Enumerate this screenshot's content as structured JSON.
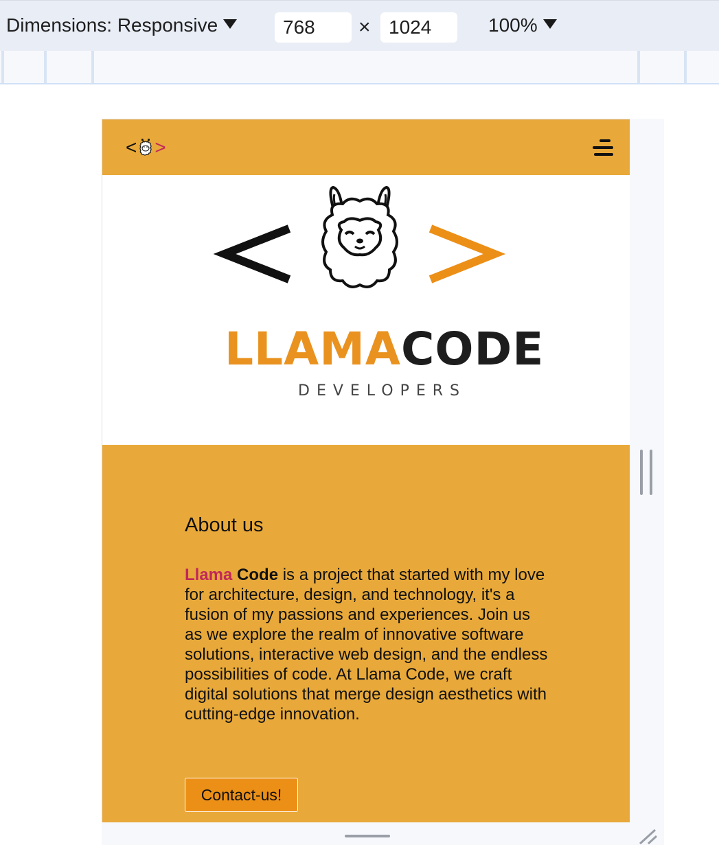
{
  "devtools": {
    "dimensions_label": "Dimensions: Responsive",
    "width_value": "768",
    "times_symbol": "×",
    "height_value": "1024",
    "zoom_label": "100%"
  },
  "site": {
    "header": {
      "logo_left": "<",
      "logo_right": ">",
      "menu_icon": "hamburger-menu-icon"
    },
    "hero": {
      "brand_part1": "LLAMA",
      "brand_part2": "CODE",
      "subtitle": "DEVELOPERS"
    },
    "about": {
      "title": "About us",
      "brand_word_1": "Llama",
      "brand_word_2": "Code",
      "body": "is a project that started with my love for architecture, design, and technology, it's a fusion of my passions and experiences. Join us as we explore the realm of innovative software solutions, interactive web design, and the endless possibilities of code. At Llama Code, we craft digital solutions that merge design aesthetics with cutting-edge innovation.",
      "cta": "Contact-us!"
    }
  },
  "colors": {
    "header_bg": "#e8a93a",
    "accent_orange": "#e9921f",
    "accent_magenta": "#c0285a",
    "button_bg": "#ec8f17"
  }
}
